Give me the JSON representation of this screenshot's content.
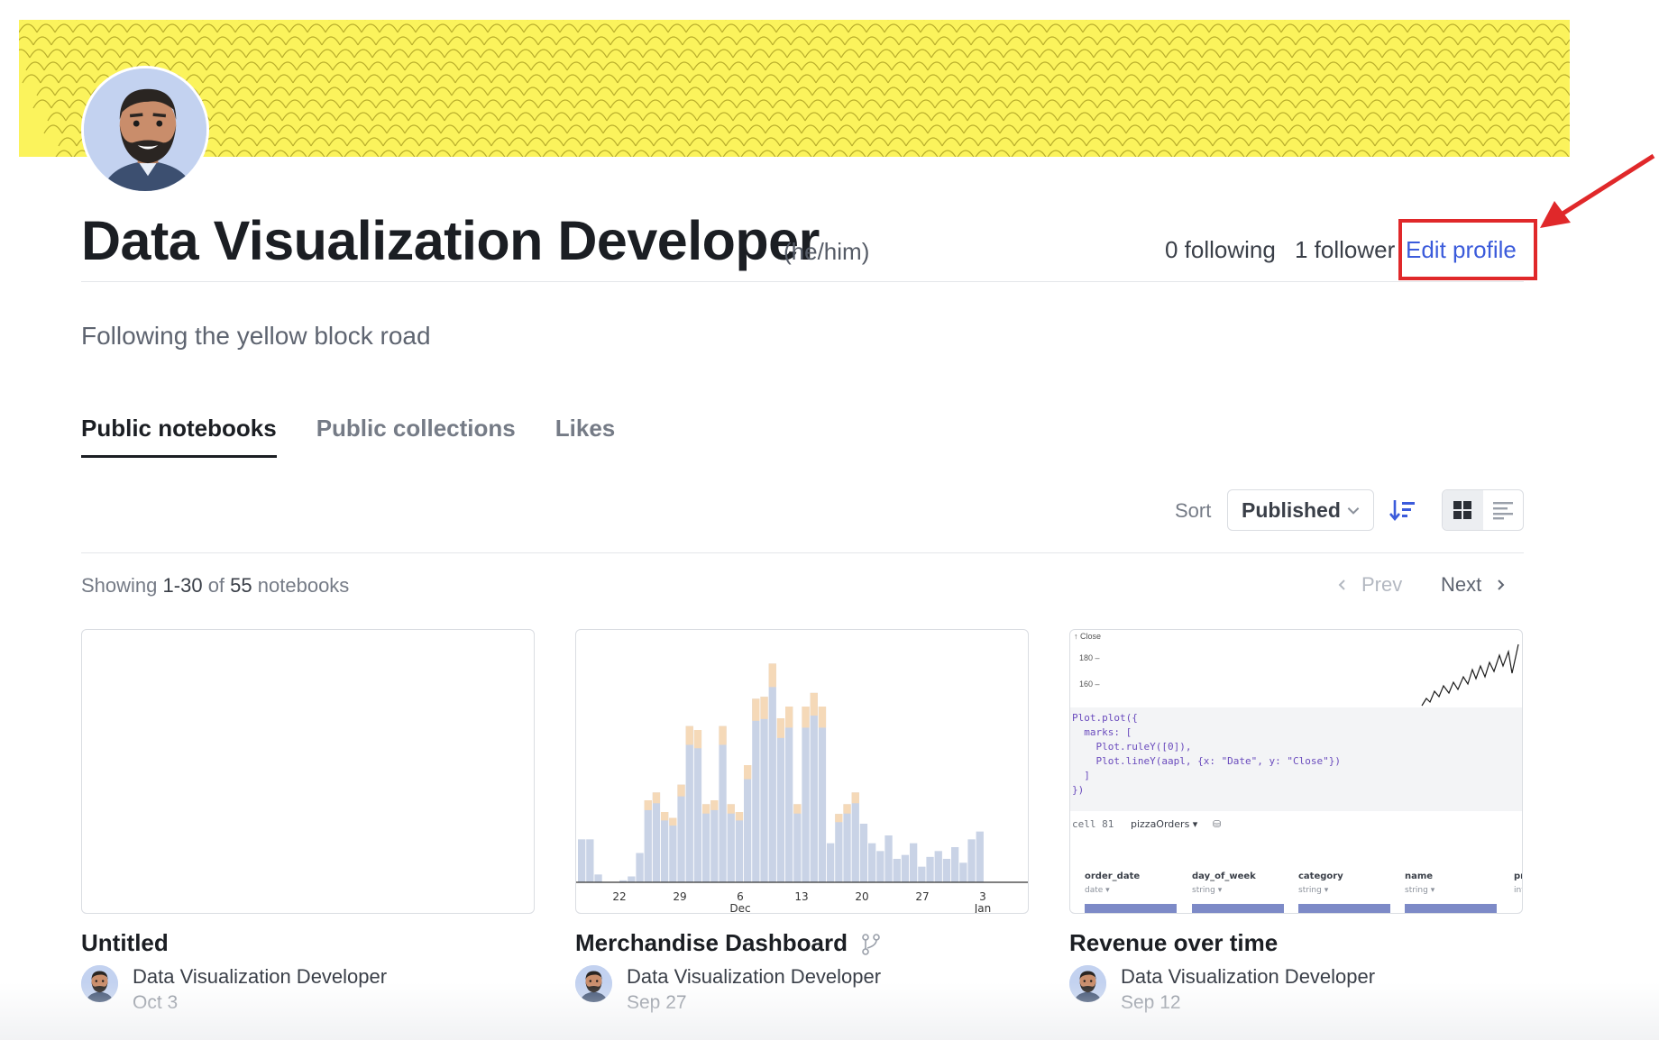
{
  "profile": {
    "name": "Data Visualization Developer",
    "pronouns": "(he/him)",
    "following": "0 following",
    "followers": "1 follower",
    "edit_label": "Edit profile",
    "bio": "Following the yellow block road",
    "banner_color": "#fbf35c",
    "avatar_bg": "#c3d2f0"
  },
  "tabs": [
    {
      "label": "Public notebooks",
      "active": true
    },
    {
      "label": "Public collections",
      "active": false
    },
    {
      "label": "Likes",
      "active": false
    }
  ],
  "toolbar": {
    "sort_label": "Sort",
    "sort_value": "Published",
    "sort_direction_icon": "sort-descending-icon",
    "views": [
      "grid-view-icon",
      "list-view-icon"
    ]
  },
  "listing": {
    "showing_prefix": "Showing",
    "range": "1-30",
    "of": "of",
    "total": "55",
    "suffix": "notebooks",
    "prev_label": "Prev",
    "next_label": "Next"
  },
  "cards": [
    {
      "title": "Untitled",
      "author": "Data Visualization Developer",
      "date": "Oct 3",
      "forked": false
    },
    {
      "title": "Merchandise Dashboard",
      "author": "Data Visualization Developer",
      "date": "Sep 27",
      "forked": true
    },
    {
      "title": "Revenue over time",
      "author": "Data Visualization Developer",
      "date": "Sep 12",
      "forked": false
    }
  ],
  "thumb_bar": {
    "tick_labels": [
      "22",
      "29",
      "6",
      "13",
      "20",
      "27",
      "3"
    ],
    "month_labels": [
      "Dec",
      "Jan"
    ],
    "base_color": "#c9d3e6",
    "top_color": "#f5d9b8",
    "values": [
      22,
      22,
      4,
      0,
      0,
      1,
      3,
      15,
      42,
      46,
      36,
      33,
      50,
      80,
      78,
      40,
      42,
      80,
      40,
      36,
      60,
      94,
      95,
      112,
      84,
      90,
      40,
      90,
      97,
      90,
      20,
      35,
      40,
      46,
      30,
      20,
      16,
      24,
      12,
      14,
      20,
      8,
      13,
      16,
      12,
      18,
      10,
      22,
      26
    ]
  },
  "thumb_code": {
    "y_axis_label": "↑ Close",
    "y_ticks": [
      "180 –",
      "160 –"
    ],
    "code_lines": [
      "Plot.plot({",
      "  marks: [",
      "    Plot.ruleY([0]),",
      "    Plot.lineY(aapl, {x: \"Date\", y: \"Close\"})",
      "  ]",
      "})"
    ],
    "cell_label": "cell 81",
    "cell_name": "pizzaOrders ▾",
    "columns": [
      {
        "name": "order_date",
        "type": "date ▾"
      },
      {
        "name": "day_of_week",
        "type": "string ▾"
      },
      {
        "name": "category",
        "type": "string ▾"
      },
      {
        "name": "name",
        "type": "string ▾"
      },
      {
        "name": "pr",
        "type": "int"
      }
    ]
  },
  "annotation": {
    "color": "#e0282a"
  }
}
